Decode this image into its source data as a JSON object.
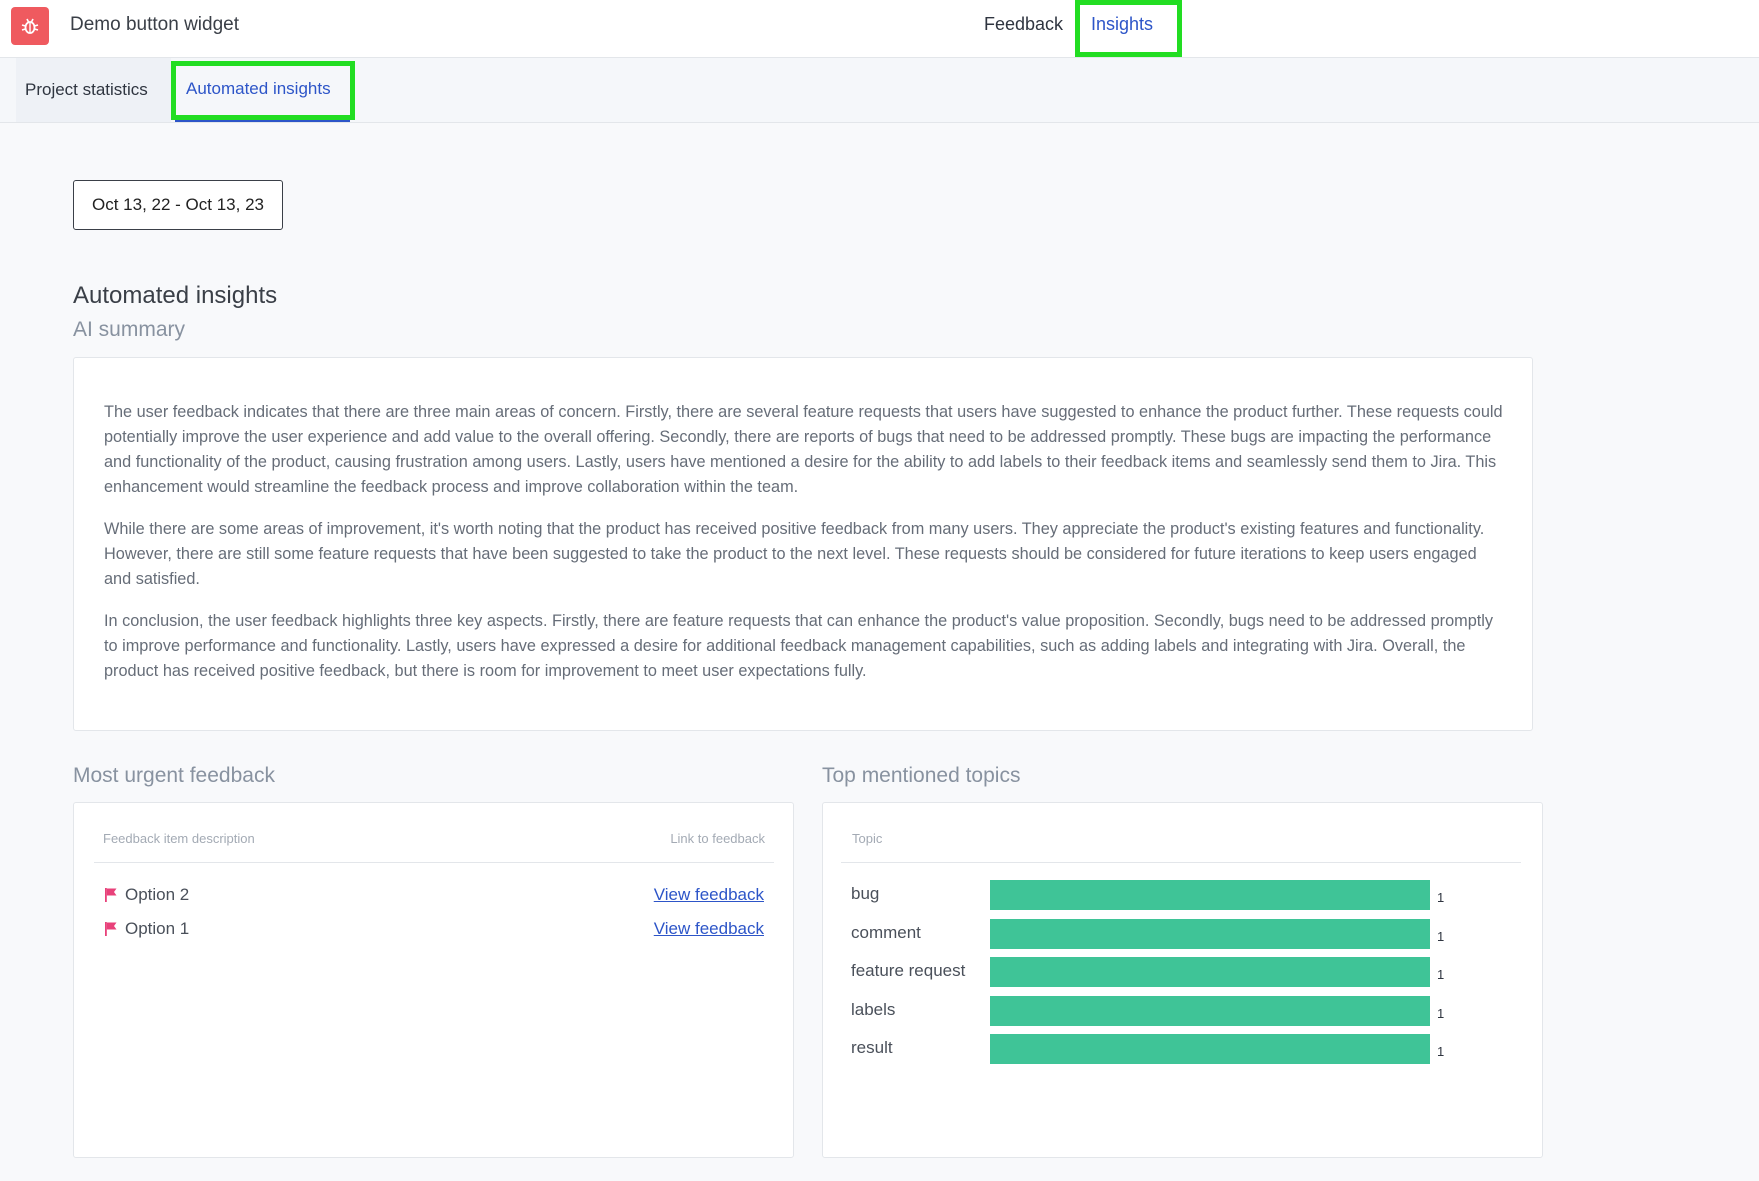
{
  "header": {
    "app_title": "Demo button widget",
    "nav": {
      "feedback": "Feedback",
      "insights": "Insights"
    }
  },
  "tabs": {
    "project_statistics": "Project statistics",
    "automated_insights": "Automated insights"
  },
  "date_range": "Oct 13, 22 - Oct 13, 23",
  "automated_insights": {
    "title": "Automated insights",
    "subtitle": "AI summary",
    "paragraphs": [
      "The user feedback indicates that there are three main areas of concern. Firstly, there are several feature requests that users have suggested to enhance the product further. These requests could potentially improve the user experience and add value to the overall offering. Secondly, there are reports of bugs that need to be addressed promptly. These bugs are impacting the performance and functionality of the product, causing frustration among users. Lastly, users have mentioned a desire for the ability to add labels to their feedback items and seamlessly send them to Jira. This enhancement would streamline the feedback process and improve collaboration within the team.",
      "While there are some areas of improvement, it's worth noting that the product has received positive feedback from many users. They appreciate the product's existing features and functionality. However, there are still some feature requests that have been suggested to take the product to the next level. These requests should be considered for future iterations to keep users engaged and satisfied.",
      "In conclusion, the user feedback highlights three key aspects. Firstly, there are feature requests that can enhance the product's value proposition. Secondly, bugs need to be addressed promptly to improve performance and functionality. Lastly, users have expressed a desire for additional feedback management capabilities, such as adding labels and integrating with Jira. Overall, the product has received positive feedback, but there is room for improvement to meet user expectations fully."
    ]
  },
  "urgent_feedback": {
    "title": "Most urgent feedback",
    "col_description": "Feedback item description",
    "col_link": "Link to feedback",
    "items": [
      {
        "label": "Option 2",
        "link": "View feedback"
      },
      {
        "label": "Option 1",
        "link": "View feedback"
      }
    ]
  },
  "top_topics": {
    "title": "Top mentioned topics",
    "col_topic": "Topic",
    "bar_color": "#3fc497"
  },
  "chart_data": {
    "type": "bar",
    "orientation": "horizontal",
    "categories": [
      "bug",
      "comment",
      "feature request",
      "labels",
      "result"
    ],
    "values": [
      1,
      1,
      1,
      1,
      1
    ],
    "xlim": [
      0,
      1
    ],
    "grid": false
  },
  "colors": {
    "accent": "#2d55c8",
    "logo": "#ef5a5f",
    "flag": "#e8417a",
    "highlight": "#22dd22"
  }
}
